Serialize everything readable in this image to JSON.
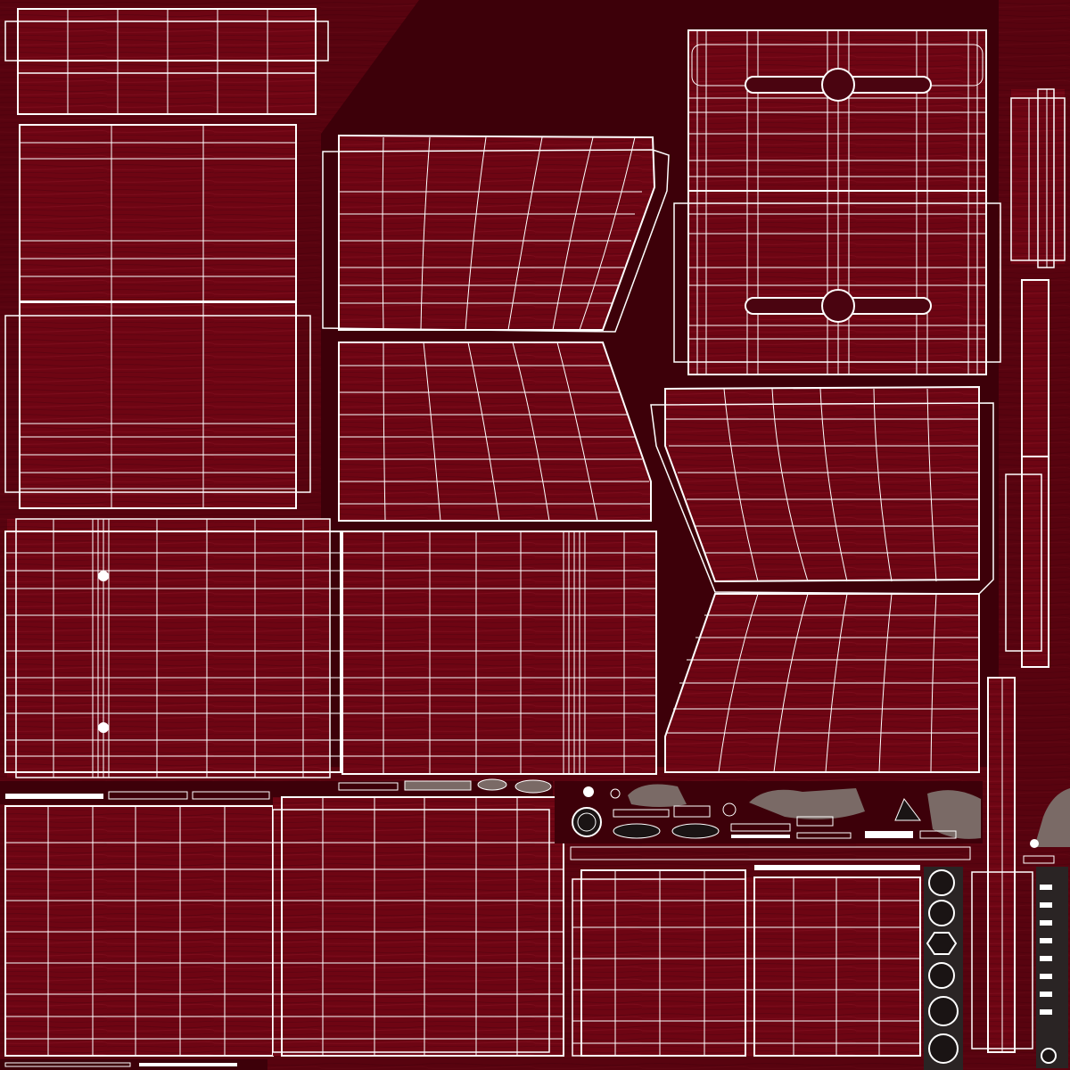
{
  "texture": {
    "wood_color": "#6e0513",
    "wood_dark": "#4a0410",
    "background_color": "#3d0009",
    "wire_color": "#ffffff",
    "parts_color": "#7a6a66",
    "parts_dark": "#1a1414"
  },
  "islands": [
    {
      "name": "uv-island-top-left-strip",
      "cols": 6,
      "rows": 2
    },
    {
      "name": "uv-island-left-upper-panel",
      "cols": 3,
      "rows": 8
    },
    {
      "name": "uv-island-left-mid-panel",
      "cols": 3,
      "rows": 9
    },
    {
      "name": "uv-island-center-upper-panel",
      "cols": 6,
      "rows": 9
    },
    {
      "name": "uv-island-center-lower-panel",
      "cols": 6,
      "rows": 8
    },
    {
      "name": "uv-island-right-top-panel",
      "cols": 7,
      "rows": 7
    },
    {
      "name": "uv-island-right-mid-panel",
      "cols": 7,
      "rows": 8
    },
    {
      "name": "uv-island-left-lower-panel",
      "cols": 8,
      "rows": 10
    },
    {
      "name": "uv-island-center-lower-wide-panel",
      "cols": 7,
      "rows": 10
    },
    {
      "name": "uv-island-bottom-left-panel",
      "cols": 6,
      "rows": 10
    },
    {
      "name": "uv-island-bottom-center-panel",
      "cols": 6,
      "rows": 10
    },
    {
      "name": "uv-island-bottom-right-panel",
      "cols": 8,
      "rows": 8
    },
    {
      "name": "uv-island-right-edge-strips",
      "cols": 2,
      "rows": 10
    }
  ]
}
